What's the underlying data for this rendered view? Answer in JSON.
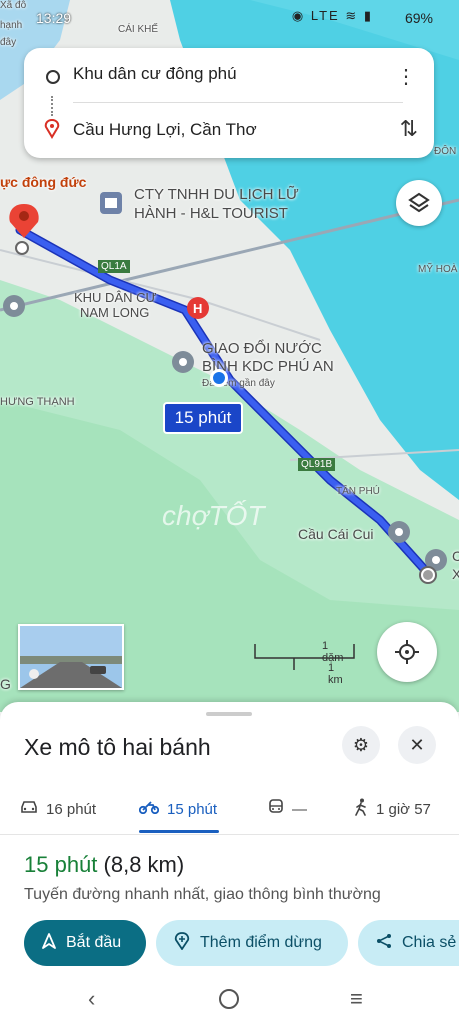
{
  "status_bar": {
    "time": "13:29",
    "signal": "LTE",
    "battery": "69%"
  },
  "map": {
    "labels": {
      "top_left_1": "Xã đô",
      "top_left_2": "hạnh",
      "top_left_3": "đây",
      "cai_khe": "CÁI KHẾ",
      "dong": "ĐÔN",
      "duc": "ực đông đức",
      "company_1": "CTY TNHH DU LỊCH LỮ",
      "company_2": "HÀNH - H&L TOURIST",
      "ql1a": "QL1A",
      "my_hoa": "MỸ HOÀ",
      "khu_dan_cu_1": "KHU DÂN CƯ",
      "khu_dan_cu_2": "NAM LONG",
      "giao_doi_1": "GIAO ĐỔI NƯỚC",
      "giao_doi_2": "BÌNH KDC PHÚ AN",
      "recent": "Đã xem gần đây",
      "hung_thanh": "HƯNG THẠNH",
      "ql91b": "QL91B",
      "tan_phu": "TÂN PHÚ",
      "cau_cai_cui": "Cầu Cái Cui",
      "right_c": "C",
      "right_x": "X",
      "g": "G"
    },
    "time_bubble": "15 phút",
    "scale": {
      "mi": "1 dặm",
      "km": "1 km"
    },
    "watermark": "chợTỐT"
  },
  "search": {
    "origin": "Khu dân cư đông phú",
    "destination": "Cầu Hưng Lợi, Cần Thơ"
  },
  "sheet": {
    "title": "Xe mô tô hai bánh",
    "tabs": [
      {
        "label": "16 phút",
        "icon": "car-icon"
      },
      {
        "label": "15 phút",
        "icon": "motorcycle-icon"
      },
      {
        "label": "—",
        "icon": "transit-icon"
      },
      {
        "label": "1 giờ 57",
        "icon": "walk-icon"
      }
    ],
    "eta_time": "15 phút",
    "eta_distance": "(8,8 km)",
    "description": "Tuyến đường nhanh nhất, giao thông bình thường",
    "buttons": {
      "start": "Bắt đầu",
      "add_stop": "Thêm điểm dừng",
      "share": "Chia sẻ"
    }
  },
  "colors": {
    "route": "#2b4ee6",
    "primary_button": "#0b6e84",
    "eta_green": "#188038",
    "water": "#3fc8dc"
  }
}
